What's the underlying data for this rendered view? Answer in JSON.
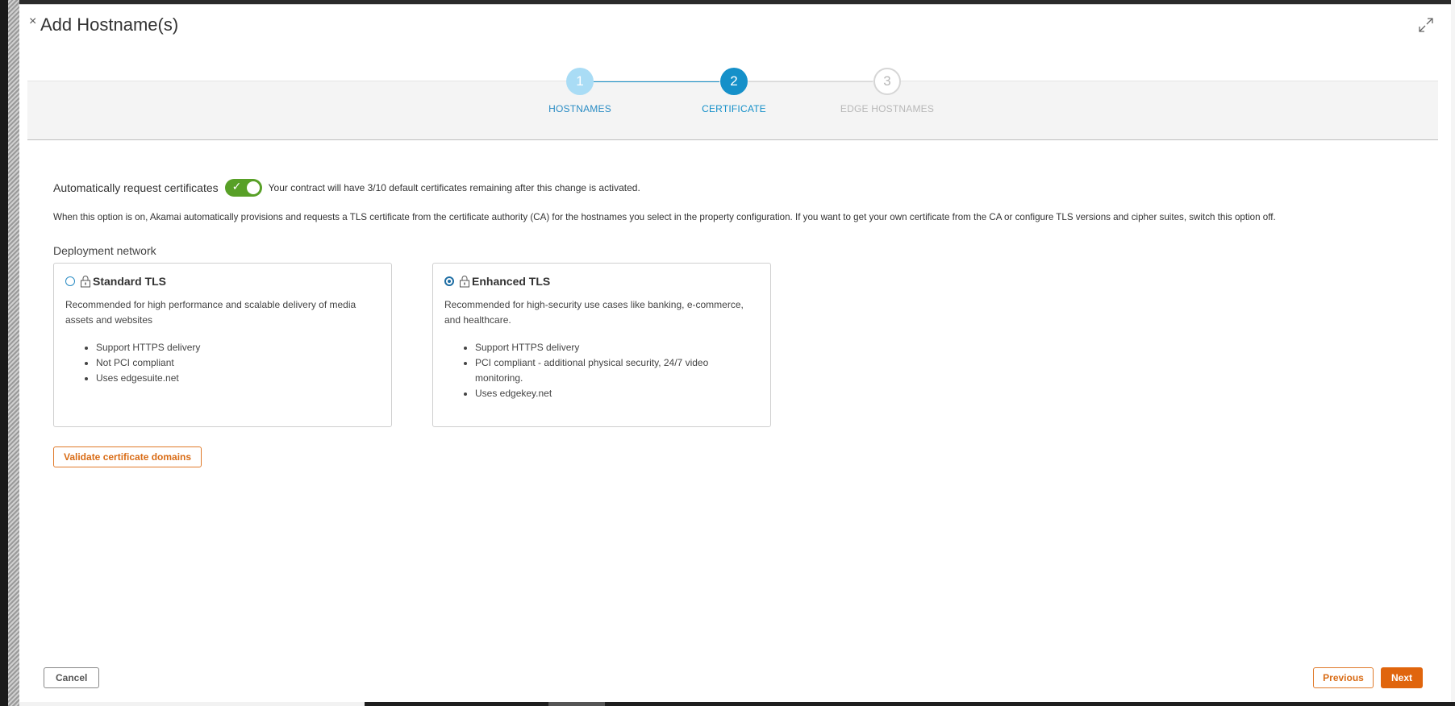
{
  "modal": {
    "title": "Add Hostname(s)",
    "close_glyph": "×"
  },
  "stepper": {
    "steps": [
      {
        "number": "1",
        "label": "HOSTNAMES",
        "state": "completed"
      },
      {
        "number": "2",
        "label": "CERTIFICATE",
        "state": "active"
      },
      {
        "number": "3",
        "label": "EDGE HOSTNAMES",
        "state": "upcoming"
      }
    ]
  },
  "certificate": {
    "auto_label": "Automatically request certificates",
    "auto_enabled": true,
    "contract_note": "Your contract will have 3/10 default certificates remaining after this change is activated.",
    "explanation": "When this option is on, Akamai automatically provisions and requests a TLS certificate from the certificate authority (CA) for the hostnames you select in the property configuration. If you want to get your own certificate from the CA or configure TLS versions and cipher suites, switch this option off.",
    "deployment_label": "Deployment network"
  },
  "cards": [
    {
      "title": "Standard TLS",
      "selected": false,
      "description": "Recommended for high performance and scalable delivery of media assets and websites",
      "bullets": [
        "Support HTTPS delivery",
        "Not PCI compliant",
        "Uses edgesuite.net"
      ]
    },
    {
      "title": "Enhanced TLS",
      "selected": true,
      "description": "Recommended for high-security use cases like banking, e-commerce, and healthcare.",
      "bullets": [
        "Support HTTPS delivery",
        "PCI compliant - additional physical security, 24/7 video monitoring.",
        "Uses edgekey.net"
      ]
    }
  ],
  "buttons": {
    "validate": "Validate certificate domains",
    "cancel": "Cancel",
    "previous": "Previous",
    "next": "Next"
  },
  "colors": {
    "accent_blue": "#1590c9",
    "toggle_green": "#58a027",
    "action_orange": "#e0650d"
  }
}
